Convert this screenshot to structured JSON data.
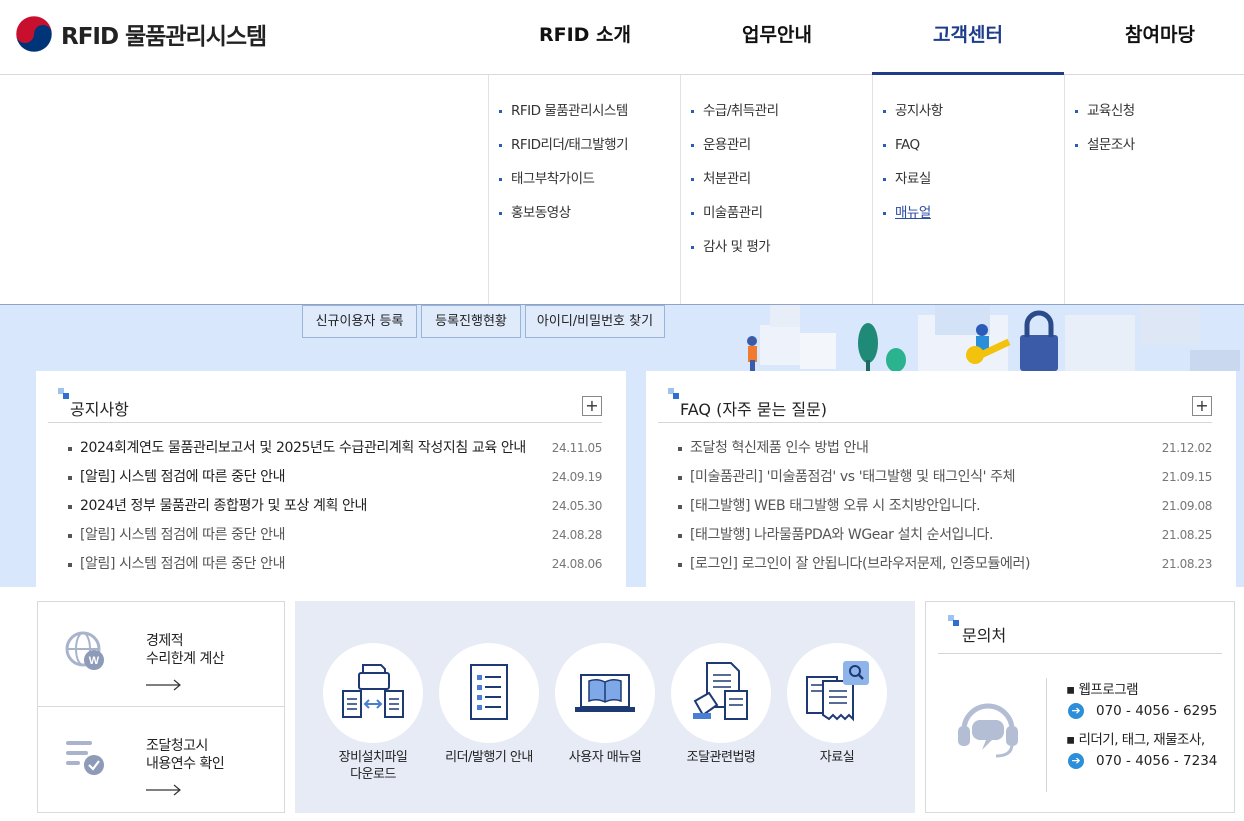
{
  "header": {
    "logo_text": "RFID 물품관리시스템",
    "nav": [
      "RFID 소개",
      "업무안내",
      "고객센터",
      "참여마당"
    ],
    "active_nav": "고객센터"
  },
  "mega_menu": {
    "col1": [
      "RFID 물품관리시스템",
      "RFID리더/태그발행기",
      "태그부착가이드",
      "홍보동영상"
    ],
    "col2": [
      "수급/취득관리",
      "운용관리",
      "처분관리",
      "미술품관리",
      "감사 및 평가"
    ],
    "col3": [
      "공지사항",
      "FAQ",
      "자료실",
      "매뉴얼"
    ],
    "col4": [
      "교육신청",
      "설문조사"
    ]
  },
  "quick_buttons": [
    "신규이용자 등록",
    "등록진행현황",
    "아이디/비밀번호 찾기"
  ],
  "notice": {
    "title": "공지사항",
    "plus": "+",
    "items": [
      {
        "title": "2024회계연도 물품관리보고서 및 2025년도 수급관리계획 작성지침 교육 안내",
        "date": "24.11.05"
      },
      {
        "title": "[알림] 시스템 점검에 따른 중단 안내",
        "date": "24.09.19"
      },
      {
        "title": "2024년 정부 물품관리 종합평가 및 포상 계획 안내",
        "date": "24.05.30"
      },
      {
        "title": "[알림] 시스템 점검에 따른 중단 안내",
        "date": "24.08.28"
      },
      {
        "title": "[알림] 시스템 점검에 따른 중단 안내",
        "date": "24.08.06"
      }
    ]
  },
  "faq": {
    "title": "FAQ (자주 묻는 질문)",
    "plus": "+",
    "items": [
      {
        "title": "조달청 혁신제품 인수 방법 안내",
        "date": "21.12.02"
      },
      {
        "title": "[미술품관리] '미술품점검' vs '태그발행 및 태그인식' 주체",
        "date": "21.09.15"
      },
      {
        "title": "[태그발행] WEB 태그발행 오류 시 조치방안입니다.",
        "date": "21.09.08"
      },
      {
        "title": "[태그발행] 나라물품PDA와 WGear 설치 순서입니다.",
        "date": "21.08.25"
      },
      {
        "title": "[로그인] 로그인이 잘 안됩니다(브라우저문제, 인증모듈에러)",
        "date": "21.08.23"
      }
    ]
  },
  "calc": {
    "item1": {
      "line1": "경제적",
      "line2": "수리한계 계산"
    },
    "item2": {
      "line1": "조달청고시",
      "line2": "내용연수 확인"
    }
  },
  "quick_menu": [
    {
      "line1": "장비설치파일",
      "line2": "다운로드"
    },
    {
      "line1": "리더/발행기 안내",
      "line2": ""
    },
    {
      "line1": "사용자 매뉴얼",
      "line2": ""
    },
    {
      "line1": "조달관련법령",
      "line2": ""
    },
    {
      "line1": "자료실",
      "line2": ""
    }
  ],
  "contact": {
    "title": "문의처",
    "web_label": "▪ 웹프로그램",
    "web_phone": "070 - 4056 - 6295",
    "hw_label": "▪ 리더기, 태그, 재물조사,",
    "hw_phone": "070 - 4056 - 7234"
  },
  "colors": {
    "primary": "#1d3d8a",
    "band": "#d8e7fb",
    "accent": "#2d8fd9"
  }
}
